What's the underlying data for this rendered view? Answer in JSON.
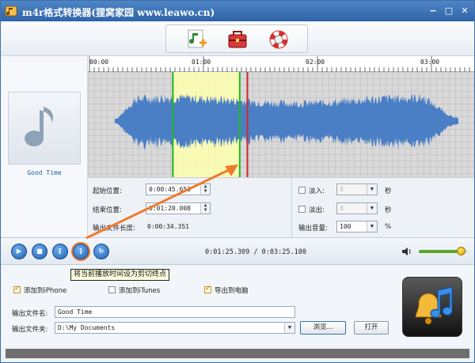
{
  "window": {
    "title": "m4r格式转换器(狸窝家园   www.leawo.cn)"
  },
  "titlebar_buttons": {
    "minimize": "−",
    "maximize": "□",
    "close": "✕"
  },
  "toolbar": {
    "items": [
      "add-music-icon",
      "toolbox-icon",
      "help-lifebuoy-icon"
    ]
  },
  "thumbnail": {
    "track_title": "Good Time"
  },
  "timeline": {
    "ticks": [
      "00:00",
      "01:00",
      "02:00",
      "03:00"
    ]
  },
  "waveform": {
    "selection_color": "#ffffb0",
    "wave_color": "#4a7fc5",
    "start_marker_color": "#1fb81f",
    "playhead_color": "#d62828",
    "selection_start_frac": 0.22,
    "selection_end_frac": 0.393,
    "playhead_frac": 0.413
  },
  "params": {
    "start_label": "起始位置:",
    "start_value": "0:00:45.653",
    "end_label": "结束位置:",
    "end_value": "0:01:20.008",
    "length_label": "输出文件长度:",
    "length_value": "0:00:34.351",
    "fade_in_label": "淡入:",
    "fade_in_value": "3",
    "fade_in_unit": "秒",
    "fade_out_label": "淡出:",
    "fade_out_value": "3",
    "fade_out_unit": "秒",
    "volume_label": "输出音量:",
    "volume_value": "100",
    "volume_unit": "%"
  },
  "transport": {
    "time_readout": "0:01:25.309 / 0:03:25.100",
    "tooltip": "将当前播放时间设为剪切终点",
    "volume_level": 0.85
  },
  "bottom": {
    "add_iphone_label": "添加到iPhone",
    "add_iphone_checked": true,
    "add_itunes_label": "添加到iTunes",
    "add_itunes_checked": false,
    "export_pc_label": "导出到电脑",
    "export_pc_checked": true,
    "filename_label": "输出文件名:",
    "filename_value": "Good Time",
    "folder_label": "输出文件夹:",
    "folder_value": "D:\\My Documents",
    "browse_label": "浏览...",
    "open_label": "打开"
  }
}
